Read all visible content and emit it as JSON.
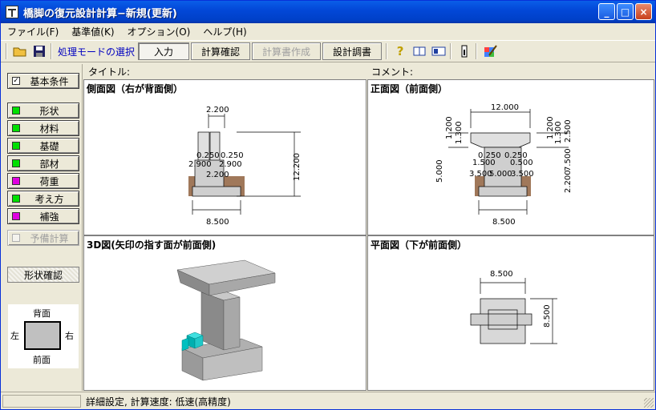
{
  "window": {
    "title": "橋脚の復元設計計算−新規(更新)",
    "buttons": [
      "_",
      "□",
      "×"
    ]
  },
  "menu": [
    "ファイル(F)",
    "基準値(K)",
    "オプション(O)",
    "ヘルプ(H)"
  ],
  "toolbar": {
    "mode_label": "処理モードの選択",
    "modes": [
      "入力",
      "計算確認",
      "計算書作成",
      "設計調書"
    ]
  },
  "headers": {
    "title_label": "タイトル:",
    "comment_label": "コメント:"
  },
  "sidebar": {
    "items": [
      {
        "label": "基本条件",
        "color": "#ffffff"
      },
      {
        "label": "形状",
        "color": "#00e000"
      },
      {
        "label": "材料",
        "color": "#00e000"
      },
      {
        "label": "基礎",
        "color": "#00e000"
      },
      {
        "label": "部材",
        "color": "#00e000"
      },
      {
        "label": "荷重",
        "color": "#e000e0"
      },
      {
        "label": "考え方",
        "color": "#00e000"
      },
      {
        "label": "補強",
        "color": "#e000e0"
      }
    ],
    "precheck": "予備計算",
    "shape_confirm": "形状確認",
    "orientation": {
      "top": "背面",
      "bottom": "前面",
      "left": "左",
      "right": "右"
    }
  },
  "views": {
    "side": {
      "title": "側面図（右が背面側）",
      "dims": [
        "2.200",
        "0.250",
        "0.250",
        "2.900",
        "2.900",
        "2.200",
        "12.200",
        "8.500"
      ]
    },
    "front": {
      "title": "正面図（前面側）",
      "dims": [
        "12.000",
        "1.200",
        "1.300",
        "1.200",
        "1.300",
        "2.500",
        "0.250",
        "0.250",
        "1.500",
        "0.500",
        "3.500",
        "5.000",
        "3.500",
        "7.500",
        "5.000",
        "2.200",
        "8.500"
      ]
    },
    "three_d": {
      "title": "3D図(矢印の指す面が前面側)"
    },
    "plan": {
      "title": "平面図（下が前面側）",
      "dims": [
        "8.500",
        "8.500"
      ]
    }
  },
  "status": {
    "text": "詳細設定, 計算速度: 低速(高精度)"
  }
}
